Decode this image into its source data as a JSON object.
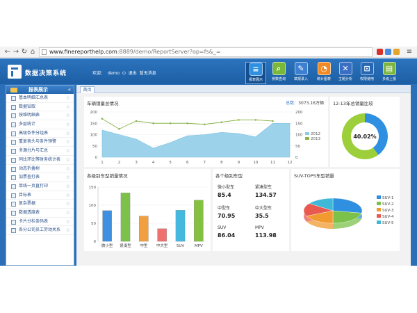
{
  "browser": {
    "url_host": "www.finereporthelp.com",
    "url_path": ":8889/demo/ReportServer?op=fs&_="
  },
  "app": {
    "title": "数据决策系统",
    "user": {
      "welcome": "欢迎：",
      "name": "demo",
      "logout": "退出",
      "messages": "暂无消息"
    },
    "toolbar": [
      {
        "label": "报表展示",
        "icon": "report-icon",
        "glyph": "≡",
        "color": "#2f8fe0",
        "active": true
      },
      {
        "label": "参数查询",
        "icon": "search-icon",
        "glyph": "⌕",
        "color": "#7ab83a"
      },
      {
        "label": "填报录入",
        "icon": "tag-icon",
        "glyph": "✎",
        "color": "#3d7fd1"
      },
      {
        "label": "统计图表",
        "icon": "pie-chart-icon",
        "glyph": "◔",
        "color": "#f08a24"
      },
      {
        "label": "主题分析",
        "icon": "crosshair-icon",
        "glyph": "✕",
        "color": "#3b6fc4"
      },
      {
        "label": "权限使用",
        "icon": "lock-icon",
        "glyph": "⊡",
        "color": "#2767b3"
      },
      {
        "label": "多级上报",
        "icon": "upload-icon",
        "glyph": "▤",
        "color": "#7bb540"
      }
    ]
  },
  "sidebar": {
    "title": "报表展示",
    "items": [
      "基本明细汇总表",
      "数据钻取",
      "按维明细表",
      "多层统计",
      "高级条件分组表",
      "重复表头与条件预警",
      "多源分片与汇总",
      "同比环比等财务统计表",
      "动态折叠树",
      "加票查打表",
      "单线一页直打印",
      "目标表",
      "复杂票据",
      "数据透度表",
      "卡片分栏条码表",
      "各分公司员工劳动关系"
    ]
  },
  "tabs": {
    "home": "首页"
  },
  "panels": {
    "sales": {
      "title": "车辆销量总情况",
      "total_label": "总数：",
      "total_value": "3073.16万辆"
    },
    "ratio": {
      "title": "12-13年总销量比较"
    },
    "levels": {
      "title": "各级别车型销量情况"
    },
    "cards": {
      "title": "各个级别车型",
      "items": [
        {
          "name": "微小型车",
          "value": "85.4"
        },
        {
          "name": "紧凑型车",
          "value": "134.57"
        },
        {
          "name": "中型车",
          "value": "70.95"
        },
        {
          "name": "中大型车",
          "value": "35.5"
        },
        {
          "name": "SUV",
          "value": "86.04"
        },
        {
          "name": "MPV",
          "value": "113.98"
        }
      ]
    },
    "suv": {
      "title": "SUV-TOP5车型销量"
    }
  },
  "chart_data": [
    {
      "type": "area",
      "x": [
        1,
        2,
        3,
        4,
        5,
        6,
        7,
        8,
        9,
        10,
        11,
        12
      ],
      "ylim_left": [
        0,
        200
      ],
      "yticks_left": [
        0,
        50,
        100,
        150,
        200
      ],
      "ylim_right": [
        0,
        200
      ],
      "yticks_right": [
        0,
        50,
        100,
        150,
        200
      ],
      "series": [
        {
          "name": "2012",
          "kind": "area",
          "color": "#8ccbe8",
          "values": [
            120,
            100,
            80,
            40,
            65,
            95,
            100,
            110,
            105,
            90,
            150,
            150
          ]
        },
        {
          "name": "2013",
          "kind": "line",
          "color": "#8bb34a",
          "values": [
            170,
            125,
            160,
            150,
            150,
            150,
            145,
            155,
            165,
            165,
            160,
            null
          ]
        }
      ]
    },
    {
      "type": "pie",
      "label": "40.02%",
      "series": [
        {
          "value": 40.02,
          "color": "#2f8fe0"
        },
        {
          "value": 59.98,
          "color": "#9ccf3a"
        }
      ]
    },
    {
      "type": "bar",
      "categories": [
        "微小型",
        "紧凑型",
        "中型",
        "中大型",
        "SUV",
        "MPV"
      ],
      "values": [
        85,
        134,
        70,
        35,
        86,
        114
      ],
      "colors": [
        "#3f8fe0",
        "#7cc24a",
        "#f0a040",
        "#f07070",
        "#45b8e0",
        "#86c040"
      ],
      "ylim": [
        0,
        150
      ],
      "yticks": [
        0,
        50,
        100,
        150
      ]
    },
    {
      "type": "pie",
      "series": [
        {
          "name": "SUV-1",
          "value": 28,
          "color": "#2f8fe0"
        },
        {
          "name": "SUV-2",
          "value": 22,
          "color": "#7cc24a"
        },
        {
          "name": "SUV-3",
          "value": 18,
          "color": "#f09a30"
        },
        {
          "name": "SUV-4",
          "value": 17,
          "color": "#e85a4f"
        },
        {
          "name": "SUV-5",
          "value": 15,
          "color": "#3fb8d8"
        }
      ]
    }
  ]
}
